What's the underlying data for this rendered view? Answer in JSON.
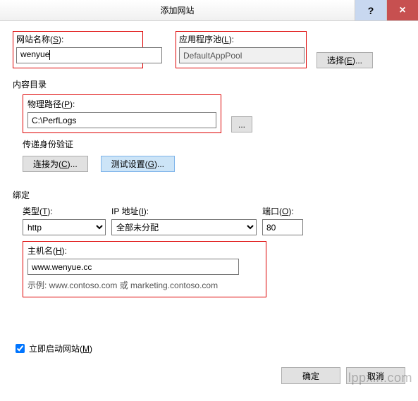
{
  "titlebar": {
    "title": "添加网站",
    "help": "?",
    "close": "×"
  },
  "site_name": {
    "label_pre": "网站名称(",
    "label_key": "S",
    "label_post": "):",
    "value": "wenyue"
  },
  "app_pool": {
    "label_pre": "应用程序池(",
    "label_key": "L",
    "label_post": "):",
    "value": "DefaultAppPool"
  },
  "select_btn": {
    "pre": "选择(",
    "key": "E",
    "post": ")..."
  },
  "content_dir": {
    "label": "内容目录"
  },
  "physical_path": {
    "label_pre": "物理路径(",
    "label_key": "P",
    "label_post": "):",
    "value": "C:\\PerfLogs"
  },
  "browse_btn": "...",
  "passthrough": {
    "label": "传递身份验证"
  },
  "connect_as": {
    "pre": "连接为(",
    "key": "C",
    "post": ")..."
  },
  "test_settings": {
    "pre": "测试设置(",
    "key": "G",
    "post": ")..."
  },
  "binding": {
    "label": "绑定"
  },
  "type": {
    "label_pre": "类型(",
    "label_key": "T",
    "label_post": "):",
    "value": "http"
  },
  "ip": {
    "label_pre": "IP 地址(",
    "label_key": "I",
    "label_post": "):",
    "value": "全部未分配"
  },
  "port": {
    "label_pre": "端口(",
    "label_key": "O",
    "label_post": "):",
    "value": "80"
  },
  "hostname": {
    "label_pre": "主机名(",
    "label_key": "H",
    "label_post": "):",
    "value": "www.wenyue.cc",
    "example": "示例: www.contoso.com 或 marketing.contoso.com"
  },
  "start_immediately": {
    "pre": "立即启动网站(",
    "key": "M",
    "post": ")"
  },
  "footer": {
    "ok": "确定",
    "cancel": "取消"
  },
  "watermark": "lppxin.com"
}
